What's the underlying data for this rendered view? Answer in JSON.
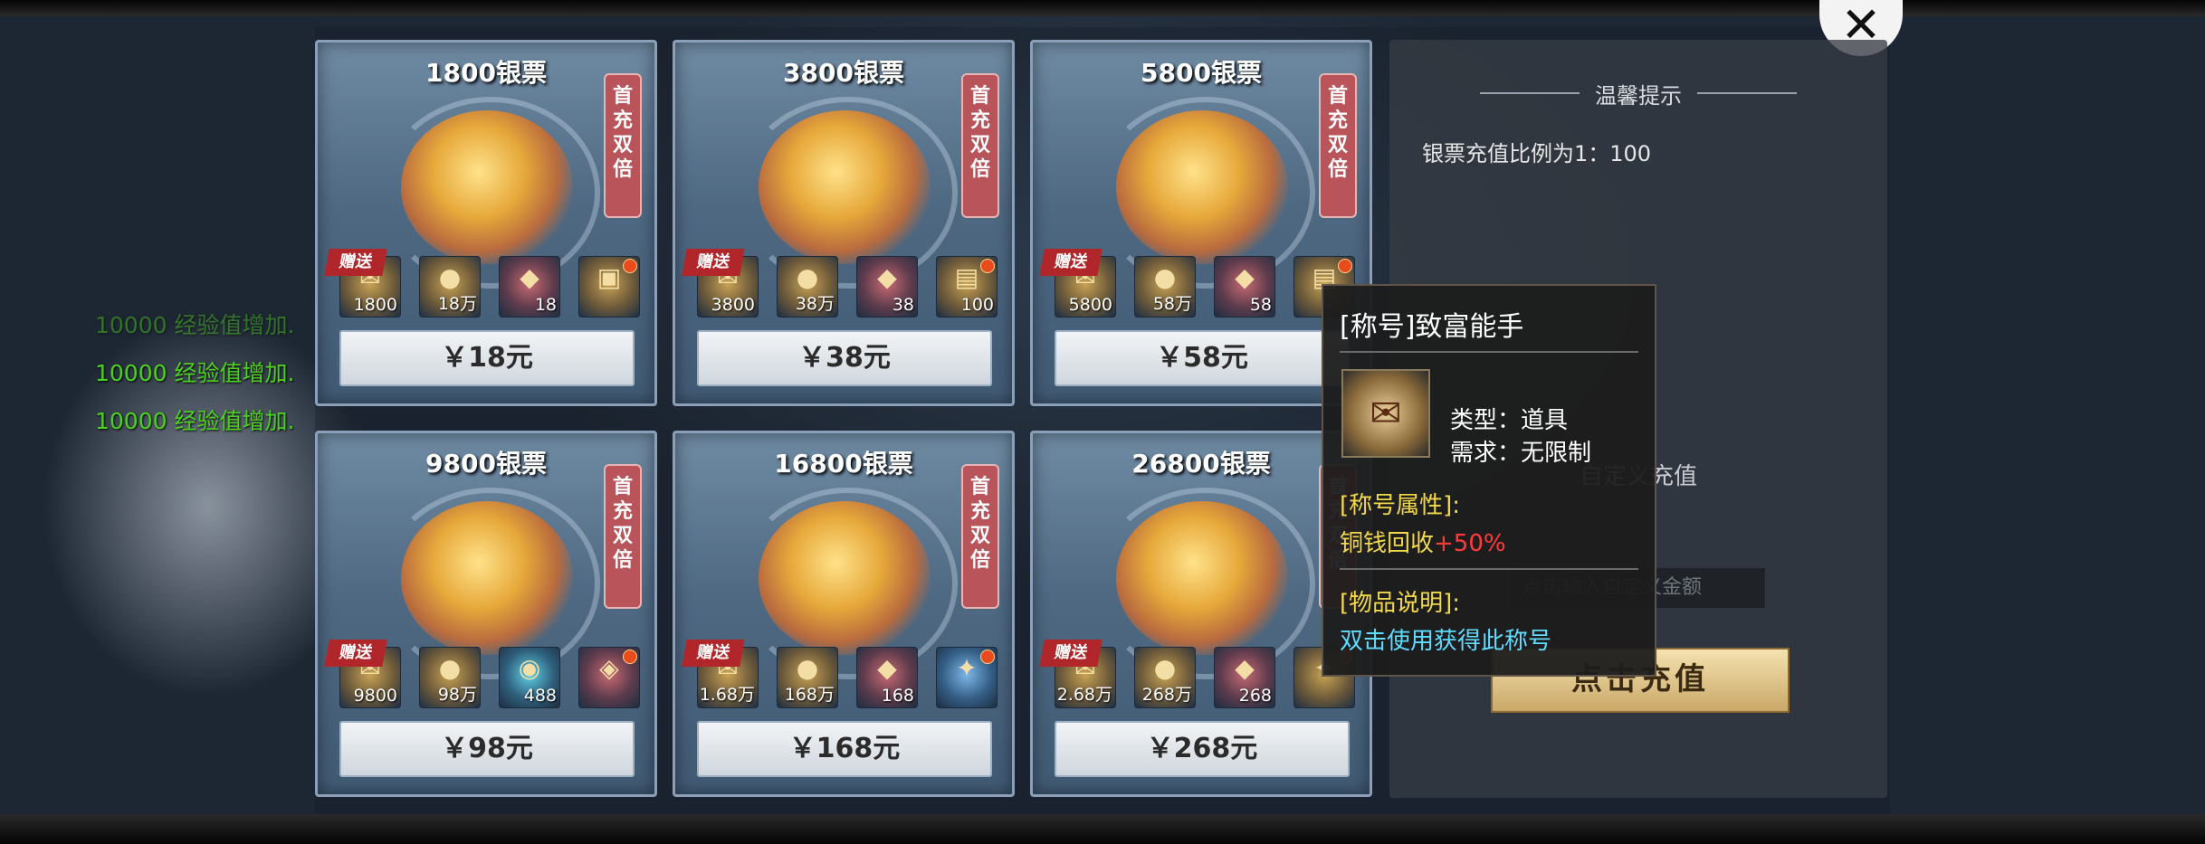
{
  "exp_log": [
    "10000 经验值增加.",
    "10000 经验值增加.",
    "10000 经验值增加."
  ],
  "ribbon_chars": [
    "首",
    "充",
    "双",
    "倍"
  ],
  "gift_label": "赠送",
  "cards": [
    {
      "title": "1800银票",
      "price": "￥18元",
      "items": [
        {
          "qty": "1800",
          "icon": "银票"
        },
        {
          "qty": "18万",
          "icon": "●"
        },
        {
          "qty": "18",
          "icon": "◆"
        },
        {
          "qty": "",
          "icon": "▣"
        }
      ]
    },
    {
      "title": "3800银票",
      "price": "￥38元",
      "items": [
        {
          "qty": "3800",
          "icon": "银票"
        },
        {
          "qty": "38万",
          "icon": "●"
        },
        {
          "qty": "38",
          "icon": "◆"
        },
        {
          "qty": "100",
          "icon": "▤"
        }
      ]
    },
    {
      "title": "5800银票",
      "price": "￥58元",
      "items": [
        {
          "qty": "5800",
          "icon": "银票"
        },
        {
          "qty": "58万",
          "icon": "●"
        },
        {
          "qty": "58",
          "icon": "◆"
        },
        {
          "qty": "",
          "icon": "▤"
        }
      ]
    },
    {
      "title": "9800银票",
      "price": "￥98元",
      "items": [
        {
          "qty": "9800",
          "icon": "银票"
        },
        {
          "qty": "98万",
          "icon": "●"
        },
        {
          "qty": "488",
          "icon": "◉"
        },
        {
          "qty": "",
          "icon": "◈"
        }
      ]
    },
    {
      "title": "16800银票",
      "price": "￥168元",
      "items": [
        {
          "qty": "1.68万",
          "icon": "银票"
        },
        {
          "qty": "168万",
          "icon": "●"
        },
        {
          "qty": "168",
          "icon": "◆"
        },
        {
          "qty": "",
          "icon": "✦"
        }
      ]
    },
    {
      "title": "26800银票",
      "price": "￥268元",
      "items": [
        {
          "qty": "2.68万",
          "icon": "银票"
        },
        {
          "qty": "268万",
          "icon": "●"
        },
        {
          "qty": "268",
          "icon": "◆"
        },
        {
          "qty": "",
          "icon": "✦"
        }
      ]
    }
  ],
  "tips": {
    "title": "温馨提示",
    "ratio": "银票充值比例为1：100",
    "custom_title": "自定义充值",
    "custom_placeholder": "点击输入自定义金额",
    "recharge_label": "点击充值"
  },
  "tooltip": {
    "title": "[称号]致富能手",
    "type": "类型：道具",
    "requirement": "需求：无限制",
    "attr_header": "[称号属性]:",
    "attr_name": "铜钱回收",
    "attr_value": "+50%",
    "desc_header": "[物品说明]:",
    "desc": "双击使用获得此称号",
    "icon": "scroll-icon"
  },
  "close_glyph": "✕"
}
